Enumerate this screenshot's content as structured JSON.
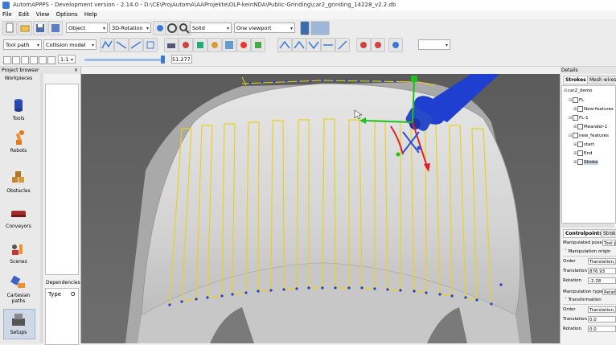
{
  "window": {
    "title": "AutomAPPPS - Development version - 2.14.0 - D:\\CE\\ProjAutomA\\AAProjekte\\OLP-keinNDA\\Public-Grinding\\car2_grinding_14228_v2.2.db"
  },
  "menu": [
    "File",
    "Edit",
    "View",
    "Options",
    "Help"
  ],
  "toolbar1": {
    "select_mode": "Object",
    "rotation_mode": "3D-Rotation",
    "render_mode": "Solid",
    "viewport_layout": "One viewport"
  },
  "toolbar2": {
    "tool_path": "Tool path",
    "collision_model": "Collision model"
  },
  "toolbar3": {
    "speed": "1:1",
    "slider_value": "51.277",
    "slider_fraction": 0.96
  },
  "project_browser": {
    "title": "Project browser",
    "categories": [
      "Workpieces",
      "Tools",
      "Robots",
      "Obstacles",
      "Conveyors",
      "Scenes",
      "Cartesian paths",
      "Setups"
    ],
    "dependencies_title": "Dependencies",
    "dep_col1": "Type",
    "dep_col2": "O"
  },
  "details": {
    "title": "Details",
    "tabs": [
      "Strokes",
      "Mesh wires"
    ],
    "tree": [
      {
        "label": "car2_demo",
        "level": 0
      },
      {
        "label": "FL",
        "level": 1
      },
      {
        "label": "New-features",
        "level": 2
      },
      {
        "label": "FL-1",
        "level": 1
      },
      {
        "label": "Meander-1",
        "level": 2
      },
      {
        "label": "new_features",
        "level": 1
      },
      {
        "label": "start",
        "level": 2
      },
      {
        "label": "End",
        "level": 2
      },
      {
        "label": "Stroke",
        "level": 2,
        "selected": true
      }
    ],
    "cp_tabs": [
      "Controlpoints",
      "Strok"
    ],
    "manip_pose_label": "Manipulated pose",
    "manip_pose_value": "Tool p",
    "manip_origin": "Manipulation origin",
    "order_label": "Order",
    "order_value": "Translation, I",
    "translation_label": "Translation",
    "translation_value": "876.93",
    "rotation_label": "Rotation",
    "rotation_value": "-2.28",
    "manip_type_label": "Manipulation type",
    "manip_type_value": "Relat",
    "transformation": "Transformation",
    "order2_value": "Translation, I",
    "translation2_value": "0.0",
    "rotation2_value": "0.0"
  },
  "colors": {
    "path": "#e8d21f",
    "points": "#1f3fd0",
    "robot": "#1f3fd0"
  }
}
